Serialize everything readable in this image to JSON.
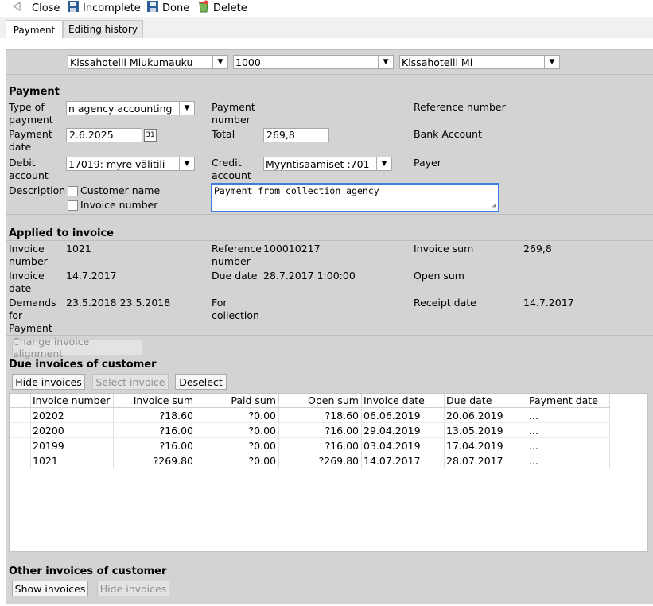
{
  "toolbar": {
    "close_label": "Close",
    "incomplete_label": "Incomplete",
    "done_label": "Done",
    "delete_label": "Delete"
  },
  "tabs": {
    "payment": "Payment",
    "history": "Editing history"
  },
  "top_selects": {
    "hotel": "Kissahotelli Miukumauku",
    "code": "1000",
    "hotel_short": "Kissahotelli Mi"
  },
  "payment": {
    "section_title": "Payment",
    "type_label_1": "Type of",
    "type_label_2": "payment",
    "type_value": "n agency accounting",
    "number_label_1": "Payment",
    "number_label_2": "number",
    "ref_label": "Reference number",
    "date_label_1": "Payment",
    "date_label_2": "date",
    "date_value": "2.6.2025",
    "calendar_day": "31",
    "total_label": "Total",
    "total_value": "269,8",
    "bank_label": "Bank Account",
    "debit_label_1": "Debit",
    "debit_label_2": "account",
    "debit_value": "17019: myre välitili",
    "credit_label_1": "Credit",
    "credit_label_2": "account",
    "credit_value": "701: Myyntisaamiset",
    "payer_label": "Payer",
    "description_label": "Description",
    "customer_name_label": "Customer name",
    "invoice_number_label": "Invoice number",
    "description_value": "Payment from collection agency"
  },
  "applied": {
    "section_title": "Applied to invoice",
    "inv_num_label_1": "Invoice",
    "inv_num_label_2": "number",
    "inv_num_value": "1021",
    "ref_label_1": "Reference",
    "ref_label_2": "number",
    "ref_value": "100010217",
    "inv_sum_label": "Invoice sum",
    "inv_sum_value": "269,8",
    "inv_date_label_1": "Invoice",
    "inv_date_label_2": "date",
    "inv_date_value": "14.7.2017",
    "due_label": "Due date",
    "due_value": "28.7.2017 1:00:00",
    "open_label": "Open sum",
    "demands_label_1": "Demands",
    "demands_label_2": "for",
    "demands_label_3": "Payment",
    "demands_value": "23.5.2018 23.5.2018",
    "collection_label_1": "For",
    "collection_label_2": "collection",
    "receipt_label": "Receipt date",
    "receipt_value": "14.7.2017",
    "change_alignment_button": "Change invoice alignment"
  },
  "due": {
    "section_title": "Due invoices of customer",
    "hide_button": "Hide invoices",
    "select_button": "Select invoice",
    "deselect_button": "Deselect",
    "columns": [
      "Invoice number",
      "Invoice sum",
      "Paid sum",
      "Open sum",
      "Invoice date",
      "Due date",
      "Payment date"
    ],
    "rows": [
      [
        "20202",
        "?18.60",
        "?0.00",
        "?18.60",
        "06.06.2019",
        "20.06.2019",
        "..."
      ],
      [
        "20200",
        "?16.00",
        "?0.00",
        "?16.00",
        "29.04.2019",
        "13.05.2019",
        "..."
      ],
      [
        "20199",
        "?16.00",
        "?0.00",
        "?16.00",
        "03.04.2019",
        "17.04.2019",
        "..."
      ],
      [
        "1021",
        "?269.80",
        "?0.00",
        "?269.80",
        "14.07.2017",
        "28.07.2017",
        "..."
      ]
    ]
  },
  "other": {
    "section_title": "Other invoices of customer",
    "show_button": "Show invoices",
    "hide_button": "Hide invoices"
  },
  "colors": {
    "panel_bg": "#d3d3d3",
    "focus_border": "#3b7de0",
    "disabled_text": "#8f8f8f"
  }
}
